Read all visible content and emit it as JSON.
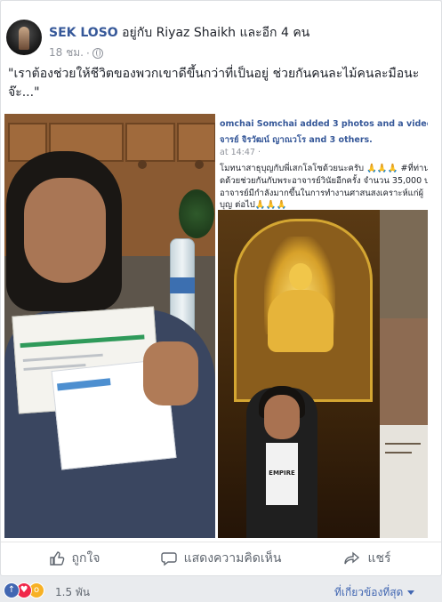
{
  "post": {
    "author": "SEK LOSO",
    "with_text": "อยู่กับ Riyaz Shaikh และอีก 4 คน",
    "time": "18 ชม.",
    "dot": "·",
    "caption": "\"เราต้องช่วยให้ชีวิตของพวกเขาดีขึ้นกว่าที่เป็นอยู่ ช่วยกันคนละไม้คนละมือนะจ๊ะ...\""
  },
  "photos": {
    "shot_line1": "omchai Somchai added 3 photos and a video — with",
    "shot_line2": "จารย์ จิรวัฒน์ ญาณวโร and 3 others.",
    "shot_line3": "at 14:47 ·",
    "shot_line4": "โมทนาสาธุบุญกับพี่เสกโลโซด้วยนะครับ 🙏🙏🙏 #ที่ท่าน",
    "shot_line5": "ดด้วยช่วยกันกับพระอาจารย์วินัยอีกครั้ง จำนวน 35,000 บ",
    "shot_line6": "อาจารย์มีกำลังมากขึ้นในการทำงานศาสนสงเคราะห์แก่ผู้",
    "shot_line7": "บุญ ต่อไป🙏🙏🙏",
    "tee_text": "EMPIRE"
  },
  "actions": {
    "like": "ถูกใจ",
    "comment": "แสดงความคิดเห็น",
    "share": "แชร์"
  },
  "reactions": {
    "count": "1.5 พัน",
    "sort": "ที่เกี่ยวข้องที่สุด"
  }
}
